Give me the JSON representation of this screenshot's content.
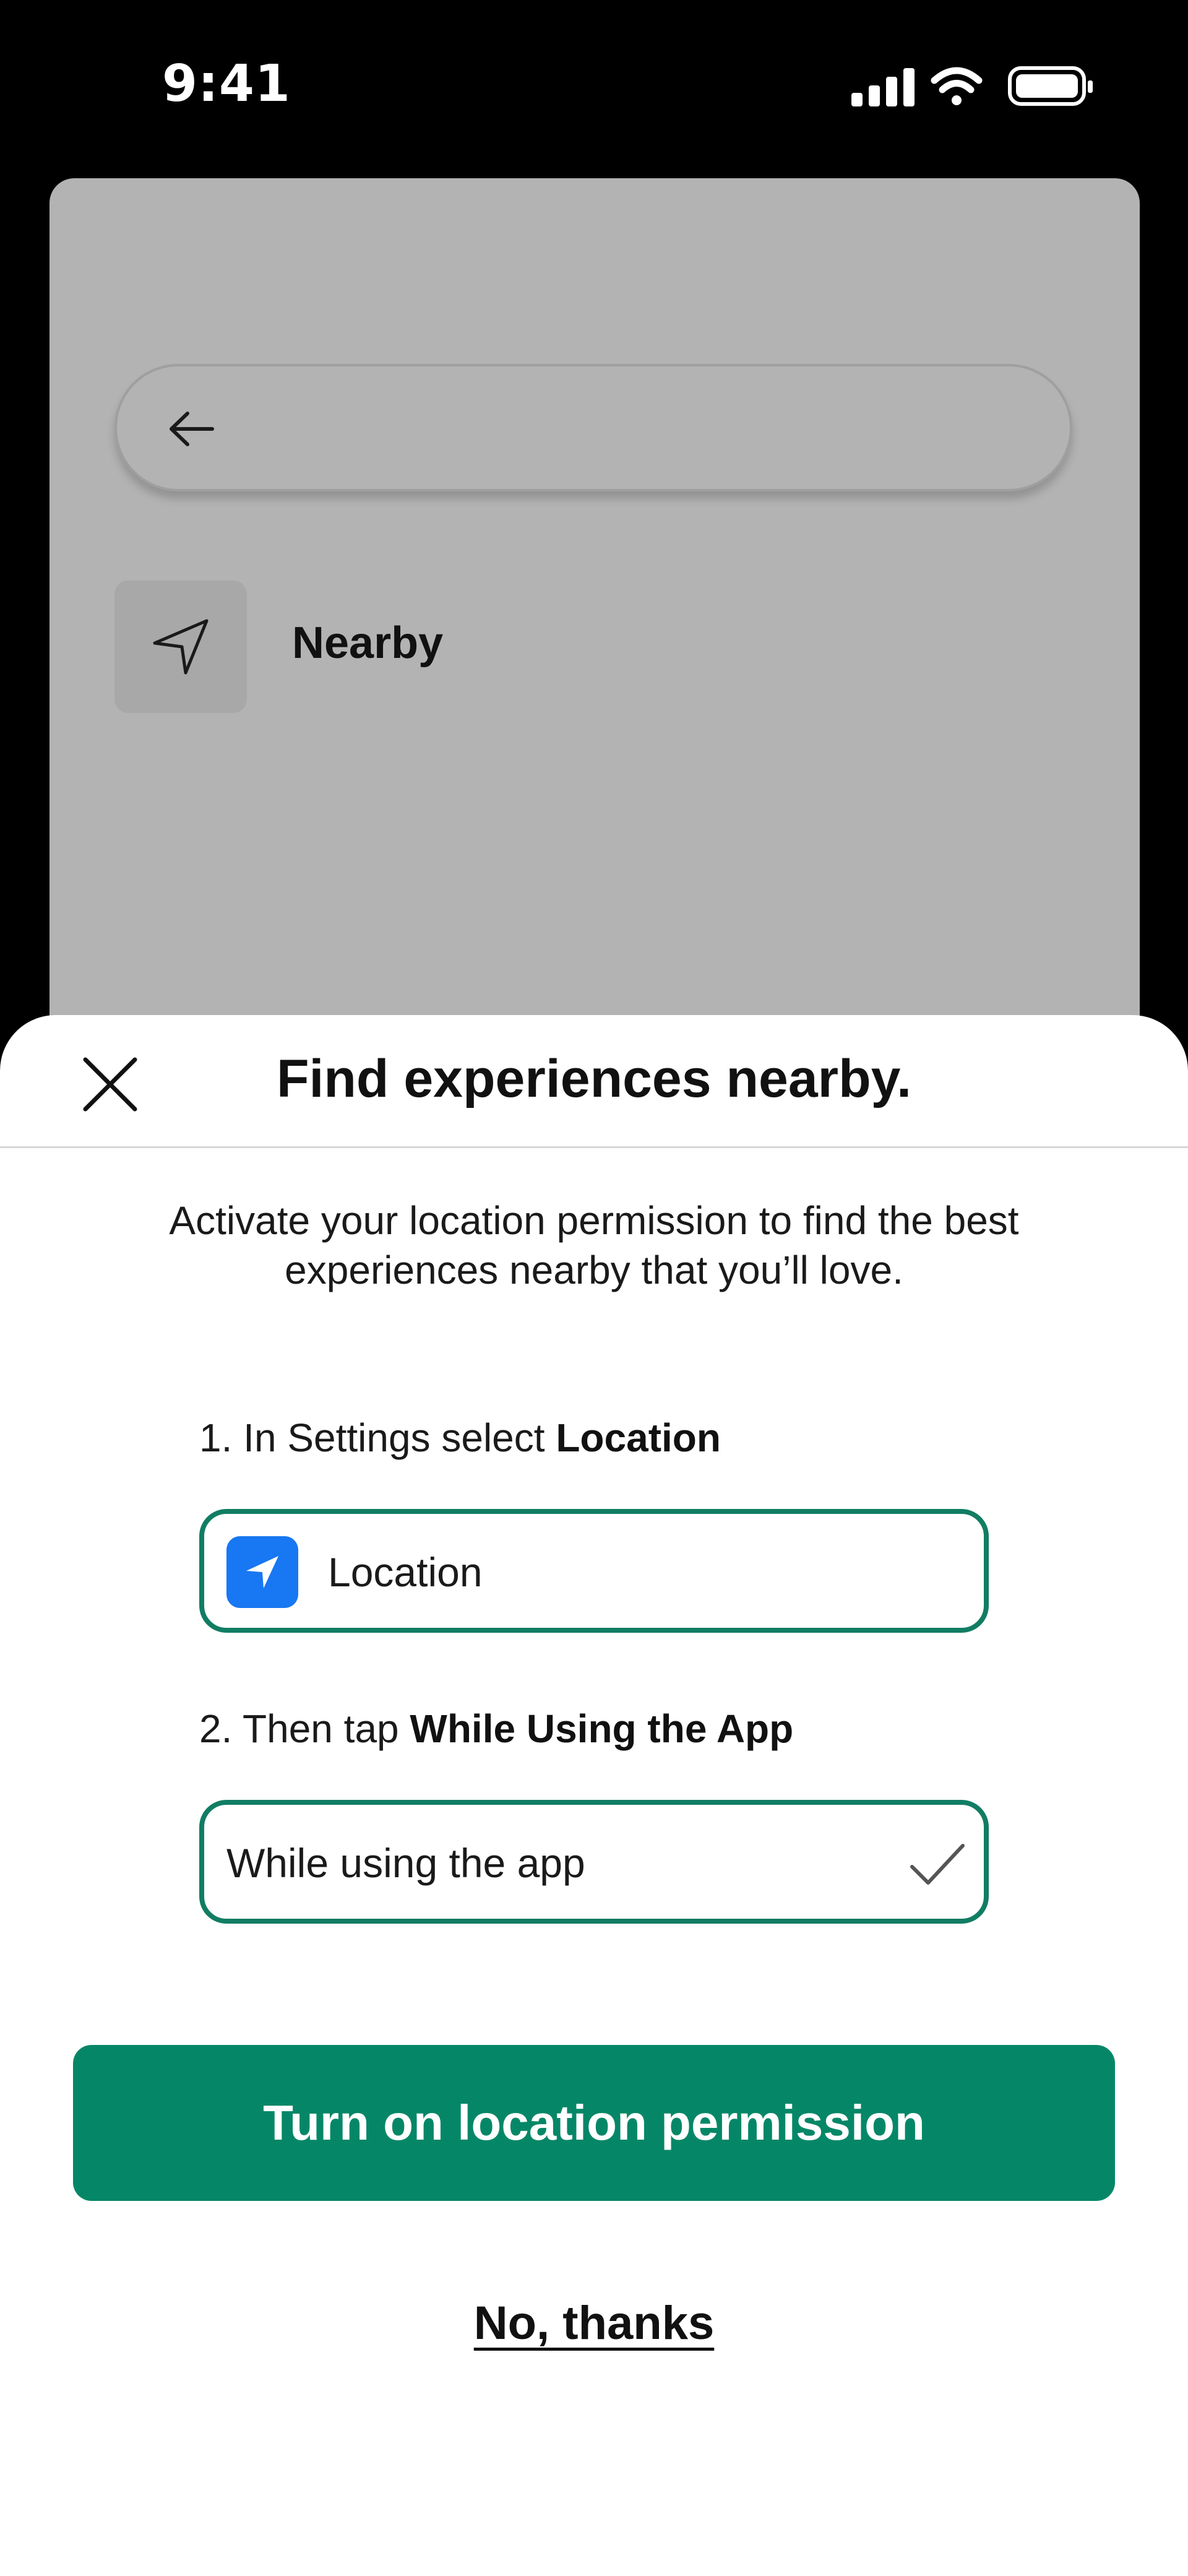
{
  "status_bar": {
    "time": "9:41",
    "icons": [
      "cellular-signal-icon",
      "wifi-icon",
      "battery-icon"
    ]
  },
  "background_screen": {
    "nearby_label": "Nearby",
    "icons": [
      "back-arrow-icon",
      "navigation-arrow-icon"
    ]
  },
  "sheet": {
    "title": "Find experiences nearby.",
    "description": "Activate your location permission to find the best experiences nearby that you’ll love.",
    "step1": {
      "prefix": "1. In Settings select ",
      "bold": "Location"
    },
    "location_option": {
      "label": "Location",
      "icon": "location-arrow-icon"
    },
    "step2": {
      "prefix": "2. Then tap ",
      "bold": "While Using the App"
    },
    "while_using_option": {
      "label": "While using the app",
      "icon": "checkmark-icon"
    },
    "primary_button": "Turn on location permission",
    "secondary_link": "No, thanks"
  },
  "colors": {
    "accent_green": "#058767",
    "option_border": "#117d63",
    "location_icon_bg": "#1877f2",
    "backdrop_gray": "#b3b3b3"
  }
}
